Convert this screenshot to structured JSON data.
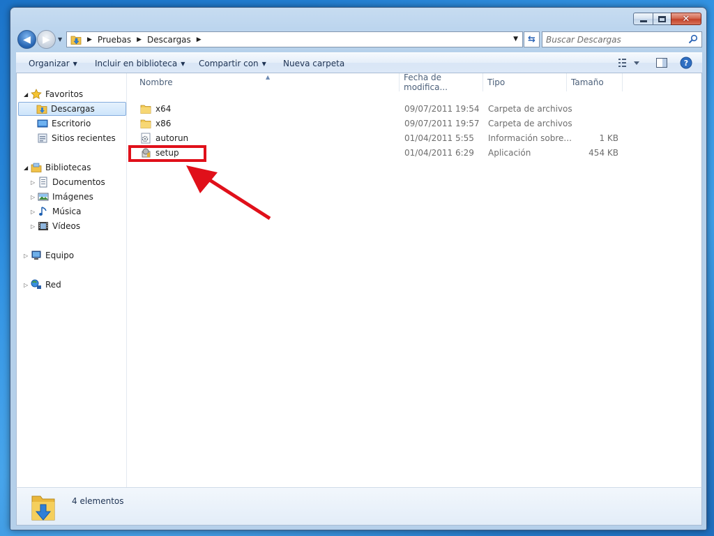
{
  "window": {
    "controls": {
      "minimize_icon": "minimize-icon",
      "maximize_icon": "restore-icon",
      "close_label": "✕"
    }
  },
  "address_bar": {
    "breadcrumbs": [
      "Pruebas",
      "Descargas"
    ],
    "search_placeholder": "Buscar Descargas"
  },
  "command_bar": {
    "organize": "Organizar",
    "include_library": "Incluir en biblioteca",
    "share": "Compartir con",
    "new_folder": "Nueva carpeta"
  },
  "nav_pane": {
    "favorites": "Favoritos",
    "favorite_items": [
      "Descargas",
      "Escritorio",
      "Sitios recientes"
    ],
    "libraries": "Bibliotecas",
    "library_items": [
      "Documentos",
      "Imágenes",
      "Música",
      "Vídeos"
    ],
    "computer": "Equipo",
    "network": "Red"
  },
  "columns": {
    "name": "Nombre",
    "date": "Fecha de modifica...",
    "type": "Tipo",
    "size": "Tamaño"
  },
  "files": [
    {
      "name": "x64",
      "date": "09/07/2011 19:54",
      "type": "Carpeta de archivos",
      "size": "",
      "icon": "folder-icon"
    },
    {
      "name": "x86",
      "date": "09/07/2011 19:57",
      "type": "Carpeta de archivos",
      "size": "",
      "icon": "folder-icon"
    },
    {
      "name": "autorun",
      "date": "01/04/2011 5:55",
      "type": "Información sobre...",
      "size": "1 KB",
      "icon": "settings-file-icon"
    },
    {
      "name": "setup",
      "date": "01/04/2011 6:29",
      "type": "Aplicación",
      "size": "454 KB",
      "icon": "setup-app-icon"
    }
  ],
  "status": {
    "count": "4 elementos"
  },
  "colors": {
    "highlight": "#e0101a",
    "accent": "#2a63b5",
    "selection": "#cde5fb"
  }
}
